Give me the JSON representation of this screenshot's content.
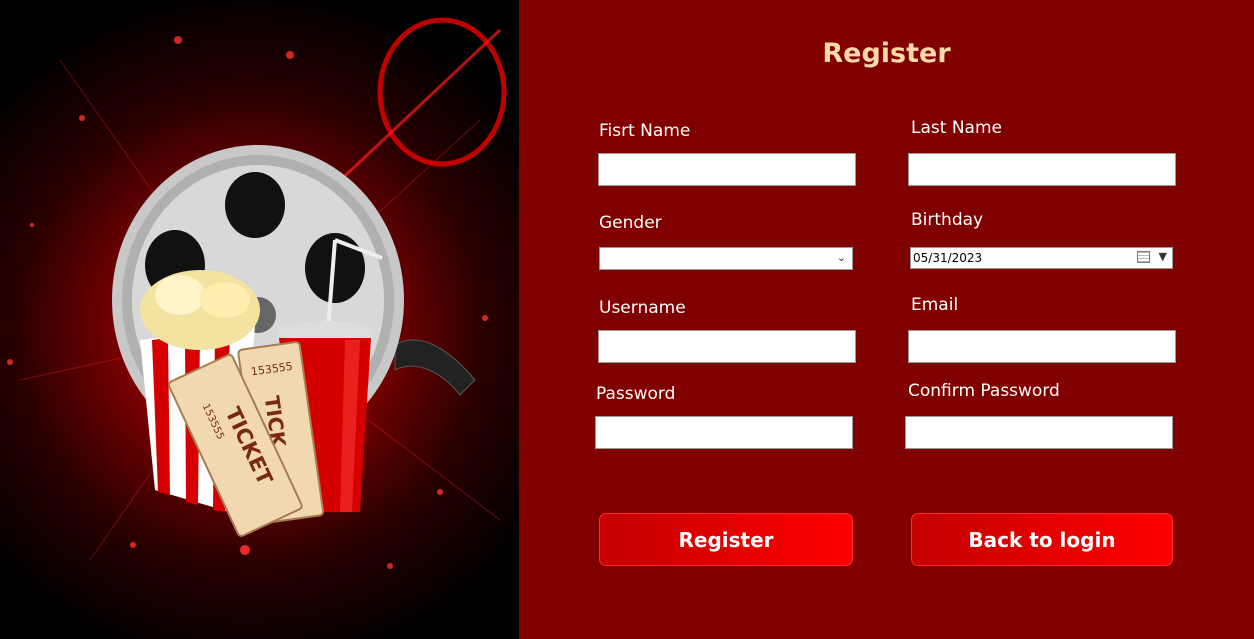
{
  "form": {
    "title": "Register",
    "first_name_label": "Fisrt Name",
    "last_name_label": "Last Name",
    "gender_label": "Gender",
    "birthday_label": "Birthday",
    "birthday_value": "05/31/2023",
    "username_label": "Username",
    "email_label": "Email",
    "password_label": "Password",
    "confirm_password_label": "Confirm Password",
    "register_button": "Register",
    "back_button": "Back to login"
  },
  "illustration": {
    "ticket_number": "153555",
    "ticket_text": "TICKET",
    "ticket_text_partial": "TICK"
  },
  "colors": {
    "panel_bg": "#800000",
    "title_color": "#ffd9a8",
    "button_gradient_start": "#c40000",
    "button_gradient_end": "#ff0000"
  }
}
